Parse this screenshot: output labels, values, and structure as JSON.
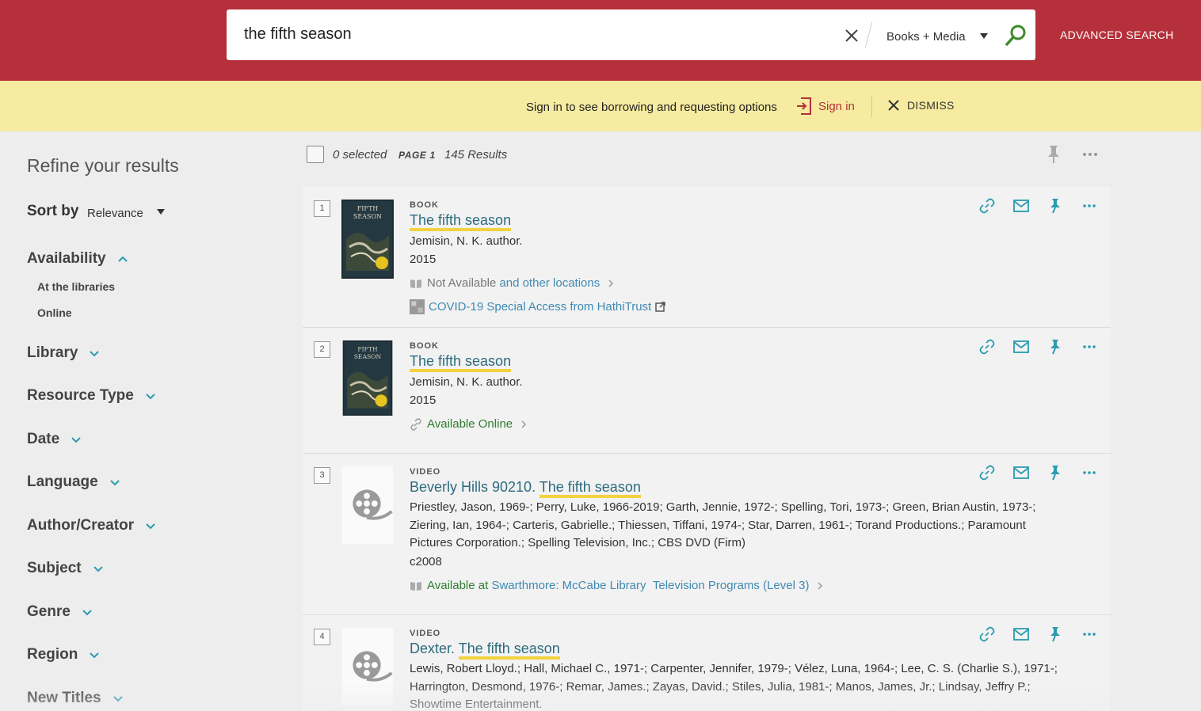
{
  "search": {
    "query": "the fifth season",
    "scope": "Books + Media",
    "advanced_label": "ADVANCED SEARCH"
  },
  "banner": {
    "message": "Sign in to see borrowing and requesting options",
    "signin_label": "Sign in",
    "dismiss_label": "DISMISS"
  },
  "sidebar": {
    "title": "Refine your results",
    "sort_label": "Sort by",
    "sort_value": "Relevance",
    "availability": {
      "label": "Availability",
      "options": [
        "At the libraries",
        "Online"
      ]
    },
    "facets": [
      "Library",
      "Resource Type",
      "Date",
      "Language",
      "Author/Creator",
      "Subject",
      "Genre",
      "Region",
      "New Titles"
    ]
  },
  "toolbar": {
    "selected": "0 selected",
    "page": "PAGE 1",
    "results": "145 Results"
  },
  "results": [
    {
      "number": "1",
      "type": "BOOK",
      "title_hl": "The fifth season",
      "author": "Jemisin, N. K. author.",
      "date": "2015",
      "availability_status": "Not Available",
      "availability_link": "and other locations",
      "extra_link": "COVID-19 Special Access from HathiTrust"
    },
    {
      "number": "2",
      "type": "BOOK",
      "title_hl": "The fifth season",
      "author": "Jemisin, N. K. author.",
      "date": "2015",
      "availability_status": "Available Online"
    },
    {
      "number": "3",
      "type": "VIDEO",
      "title_prefix": "Beverly Hills 90210.",
      "title_hl": "The fifth season",
      "contributors": "Priestley, Jason, 1969-; Perry, Luke, 1966-2019; Garth, Jennie, 1972-; Spelling, Tori, 1973-; Green, Brian Austin, 1973-; Ziering, Ian, 1964-; Carteris, Gabrielle.; Thiessen, Tiffani, 1974-; Star, Darren, 1961-; Torand Productions.; Paramount Pictures Corporation.; Spelling Television, Inc.; CBS DVD (Firm)",
      "date": "c2008",
      "availability_status": "Available at",
      "availability_location": "Swarthmore: McCabe Library",
      "availability_shelf": "Television Programs (Level 3)"
    },
    {
      "number": "4",
      "type": "VIDEO",
      "title_prefix": "Dexter.",
      "title_hl": "The fifth season",
      "contributors": "Lewis, Robert Lloyd.; Hall, Michael C., 1971-; Carpenter, Jennifer, 1979-; Vélez, Luna, 1964-; Lee, C. S. (Charlie S.), 1971-; Harrington, Desmond, 1976-; Remar, James.; Zayas, David.; Stiles, Julia, 1981-; Manos, James, Jr.; Lindsay, Jeffry P.; Showtime Entertainment."
    }
  ],
  "colors": {
    "header": "#b5303a",
    "banner": "#f6eba0",
    "link": "#2c6b7d",
    "highlight": "#f3d23f",
    "available": "#2f7d2f",
    "pin": "#2a9bb0"
  }
}
